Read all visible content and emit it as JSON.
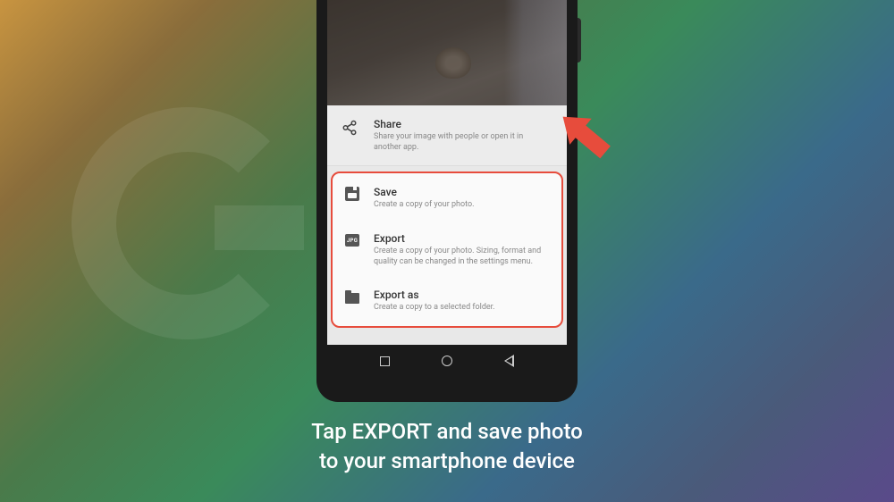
{
  "share": {
    "title": "Share",
    "desc": "Share your image with people or open it in another app."
  },
  "options": {
    "save": {
      "title": "Save",
      "desc": "Create a copy of your photo."
    },
    "export": {
      "title": "Export",
      "desc": "Create a copy of your photo. Sizing, format and quality can be changed in the settings menu."
    },
    "exportas": {
      "title": "Export as",
      "desc": "Create a copy to a selected folder."
    }
  },
  "jpg_label": "JPG",
  "caption": {
    "line1": "Tap EXPORT and save photo",
    "line2": "to your smartphone device"
  }
}
